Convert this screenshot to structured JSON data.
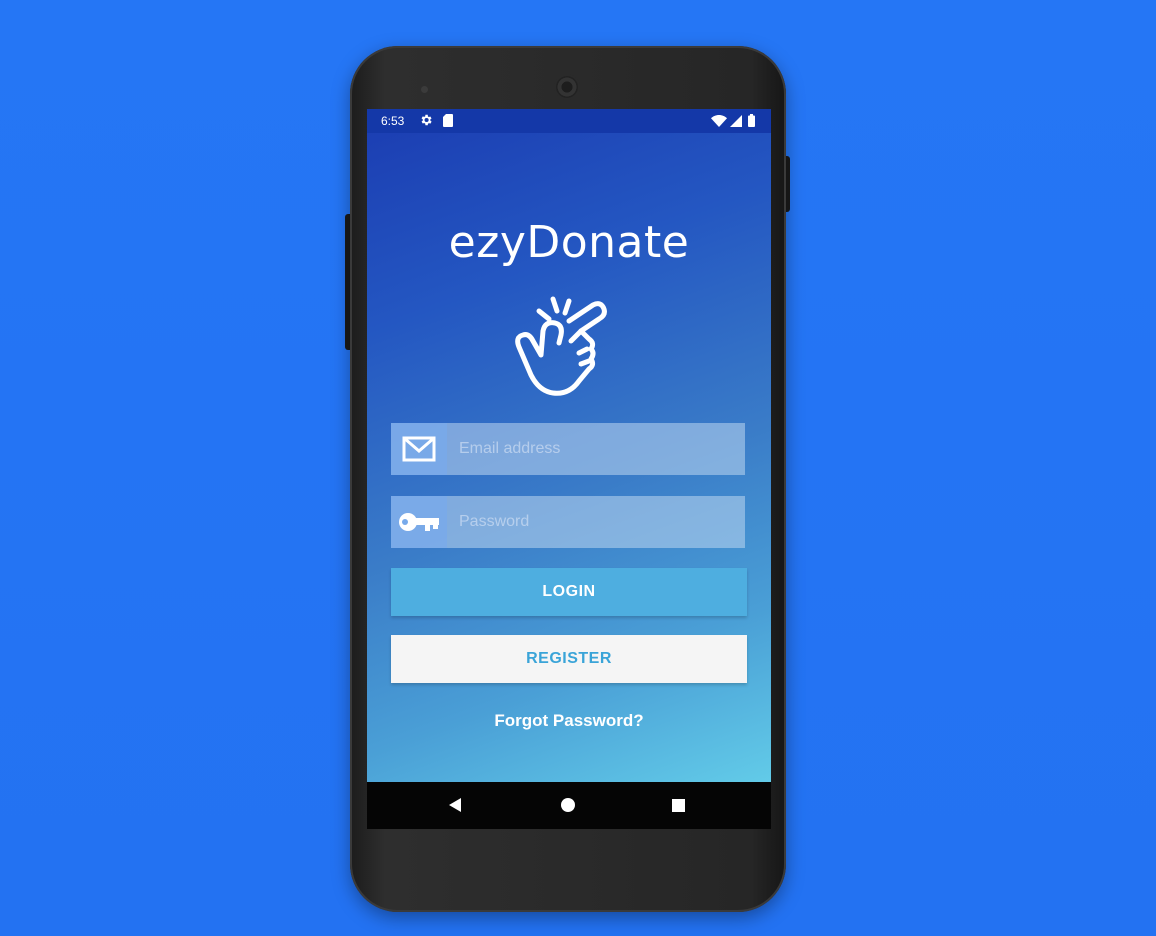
{
  "status_bar": {
    "time": "6:53",
    "icons": [
      "gear-icon",
      "sd-card-icon",
      "wifi-icon",
      "signal-icon",
      "battery-icon"
    ]
  },
  "app": {
    "title": "ezyDonate",
    "logo": "snapping-fingers-hand-icon",
    "email_field": {
      "placeholder": "Email address",
      "value": "",
      "icon": "envelope-icon"
    },
    "password_field": {
      "placeholder": "Password",
      "value": "",
      "icon": "key-icon"
    },
    "login_label": "LOGIN",
    "register_label": "REGISTER",
    "forgot_label": "Forgot Password?"
  },
  "nav_bar": {
    "buttons": [
      "back-icon",
      "home-icon",
      "recent-apps-icon"
    ]
  },
  "colors": {
    "background": "#2474f4",
    "status_bar": "#1438a8",
    "login_button": "#4eaee0",
    "register_text": "#3aa4d8",
    "register_button": "#f5f5f5"
  }
}
